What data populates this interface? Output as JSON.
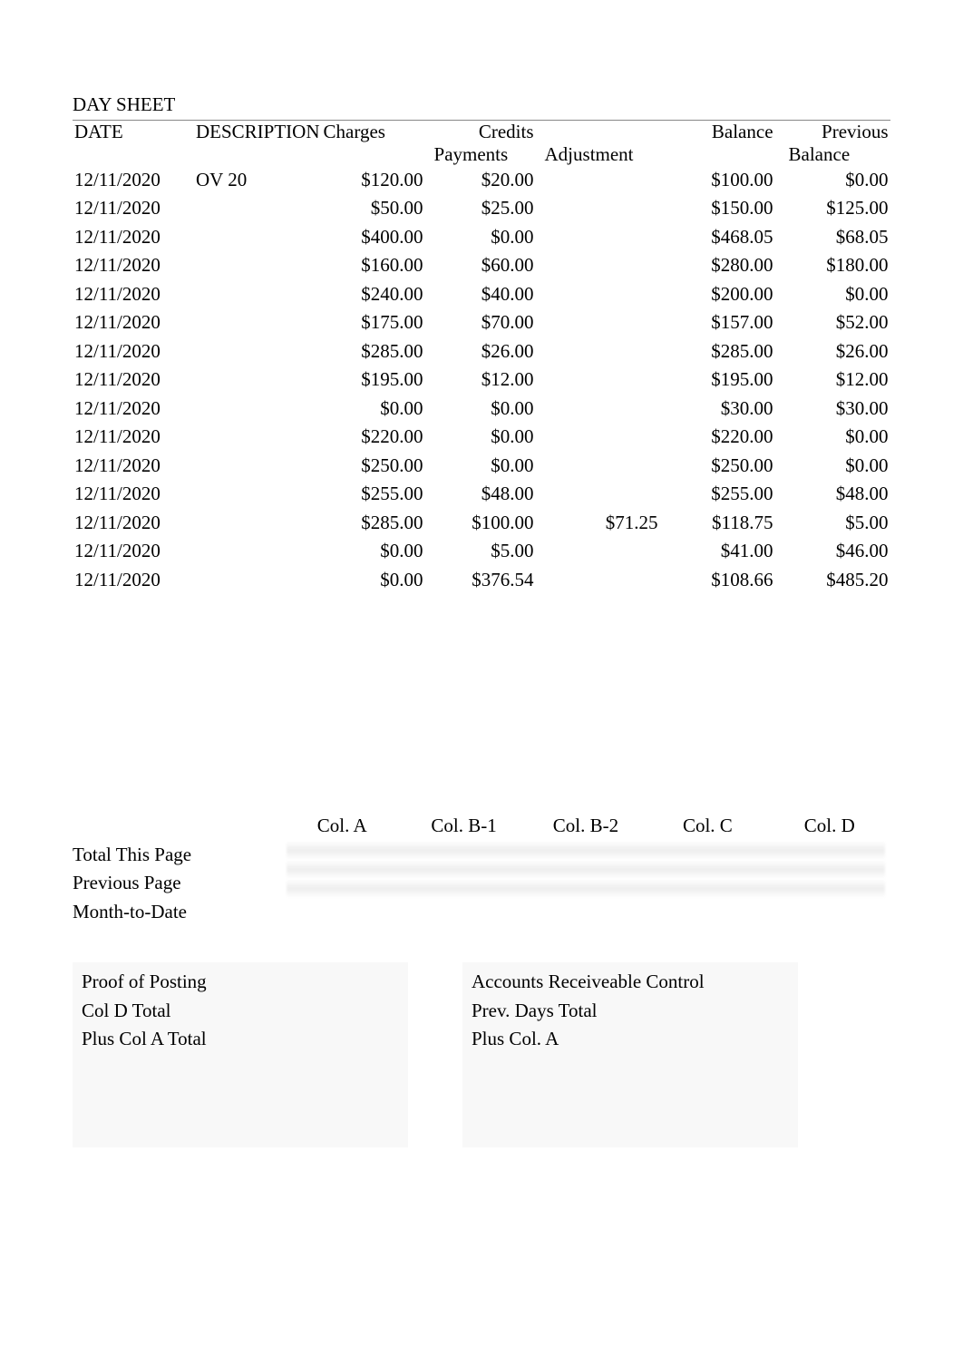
{
  "title": "DAY SHEET",
  "columns": {
    "date": "DATE",
    "description": "DESCRIPTION",
    "charges": "Charges",
    "credits": "Credits",
    "payments": "Payments",
    "adjustment": "Adjustment",
    "balance": "Balance",
    "previous": "Previous",
    "previous_balance": "Balance"
  },
  "rows": [
    {
      "date": "12/11/2020",
      "desc": "OV 20",
      "charges": "$120.00",
      "payments": "$20.00",
      "adj": "",
      "balance": "$100.00",
      "prev": "$0.00"
    },
    {
      "date": "12/11/2020",
      "desc": "",
      "charges": "$50.00",
      "payments": "$25.00",
      "adj": "",
      "balance": "$150.00",
      "prev": "$125.00"
    },
    {
      "date": "12/11/2020",
      "desc": "",
      "charges": "$400.00",
      "payments": "$0.00",
      "adj": "",
      "balance": "$468.05",
      "prev": "$68.05"
    },
    {
      "date": "12/11/2020",
      "desc": "",
      "charges": "$160.00",
      "payments": "$60.00",
      "adj": "",
      "balance": "$280.00",
      "prev": "$180.00"
    },
    {
      "date": "12/11/2020",
      "desc": "",
      "charges": "$240.00",
      "payments": "$40.00",
      "adj": "",
      "balance": "$200.00",
      "prev": "$0.00"
    },
    {
      "date": "12/11/2020",
      "desc": "",
      "charges": "$175.00",
      "payments": "$70.00",
      "adj": "",
      "balance": "$157.00",
      "prev": "$52.00"
    },
    {
      "date": "12/11/2020",
      "desc": "",
      "charges": "$285.00",
      "payments": "$26.00",
      "adj": "",
      "balance": "$285.00",
      "prev": "$26.00"
    },
    {
      "date": "12/11/2020",
      "desc": "",
      "charges": "$195.00",
      "payments": "$12.00",
      "adj": "",
      "balance": "$195.00",
      "prev": "$12.00"
    },
    {
      "date": "12/11/2020",
      "desc": "",
      "charges": "$0.00",
      "payments": "$0.00",
      "adj": "",
      "balance": "$30.00",
      "prev": "$30.00"
    },
    {
      "date": "12/11/2020",
      "desc": "",
      "charges": "$220.00",
      "payments": "$0.00",
      "adj": "",
      "balance": "$220.00",
      "prev": "$0.00"
    },
    {
      "date": "12/11/2020",
      "desc": "",
      "charges": "$250.00",
      "payments": "$0.00",
      "adj": "",
      "balance": "$250.00",
      "prev": "$0.00"
    },
    {
      "date": "12/11/2020",
      "desc": "",
      "charges": "$255.00",
      "payments": "$48.00",
      "adj": "",
      "balance": "$255.00",
      "prev": "$48.00"
    },
    {
      "date": "12/11/2020",
      "desc": "",
      "charges": "$285.00",
      "payments": "$100.00",
      "adj": "$71.25",
      "balance": "$118.75",
      "prev": "$5.00"
    },
    {
      "date": "12/11/2020",
      "desc": "",
      "charges": "$0.00",
      "payments": "$5.00",
      "adj": "",
      "balance": "$41.00",
      "prev": "$46.00"
    },
    {
      "date": "12/11/2020",
      "desc": "",
      "charges": "$0.00",
      "payments": "$376.54",
      "adj": "",
      "balance": "$108.66",
      "prev": "$485.20"
    }
  ],
  "chart_data": {
    "type": "table",
    "columns": [
      "DATE",
      "DESCRIPTION",
      "Charges",
      "Credits Payments",
      "Credits Adjustment",
      "Balance",
      "Previous Balance"
    ],
    "rows": [
      [
        "12/11/2020",
        "OV 20",
        120.0,
        20.0,
        null,
        100.0,
        0.0
      ],
      [
        "12/11/2020",
        "",
        50.0,
        25.0,
        null,
        150.0,
        125.0
      ],
      [
        "12/11/2020",
        "",
        400.0,
        0.0,
        null,
        468.05,
        68.05
      ],
      [
        "12/11/2020",
        "",
        160.0,
        60.0,
        null,
        280.0,
        180.0
      ],
      [
        "12/11/2020",
        "",
        240.0,
        40.0,
        null,
        200.0,
        0.0
      ],
      [
        "12/11/2020",
        "",
        175.0,
        70.0,
        null,
        157.0,
        52.0
      ],
      [
        "12/11/2020",
        "",
        285.0,
        26.0,
        null,
        285.0,
        26.0
      ],
      [
        "12/11/2020",
        "",
        195.0,
        12.0,
        null,
        195.0,
        12.0
      ],
      [
        "12/11/2020",
        "",
        0.0,
        0.0,
        null,
        30.0,
        30.0
      ],
      [
        "12/11/2020",
        "",
        220.0,
        0.0,
        null,
        220.0,
        0.0
      ],
      [
        "12/11/2020",
        "",
        250.0,
        0.0,
        null,
        250.0,
        0.0
      ],
      [
        "12/11/2020",
        "",
        255.0,
        48.0,
        null,
        255.0,
        48.0
      ],
      [
        "12/11/2020",
        "",
        285.0,
        100.0,
        71.25,
        118.75,
        5.0
      ],
      [
        "12/11/2020",
        "",
        0.0,
        5.0,
        null,
        41.0,
        46.0
      ],
      [
        "12/11/2020",
        "",
        0.0,
        376.54,
        null,
        108.66,
        485.2
      ]
    ]
  },
  "summary": {
    "col_headers": [
      "Col. A",
      "Col. B-1",
      "Col. B-2",
      "Col. C",
      "Col. D"
    ],
    "row_labels": [
      "Total This Page",
      "Previous Page",
      "Month-to-Date"
    ]
  },
  "proof_of_posting": {
    "title": "Proof of Posting",
    "rows": [
      "Col D Total",
      "Plus Col A Total"
    ]
  },
  "ar_control": {
    "title": "Accounts Receiveable Control",
    "rows": [
      "Prev. Days Total",
      "Plus Col. A"
    ]
  }
}
